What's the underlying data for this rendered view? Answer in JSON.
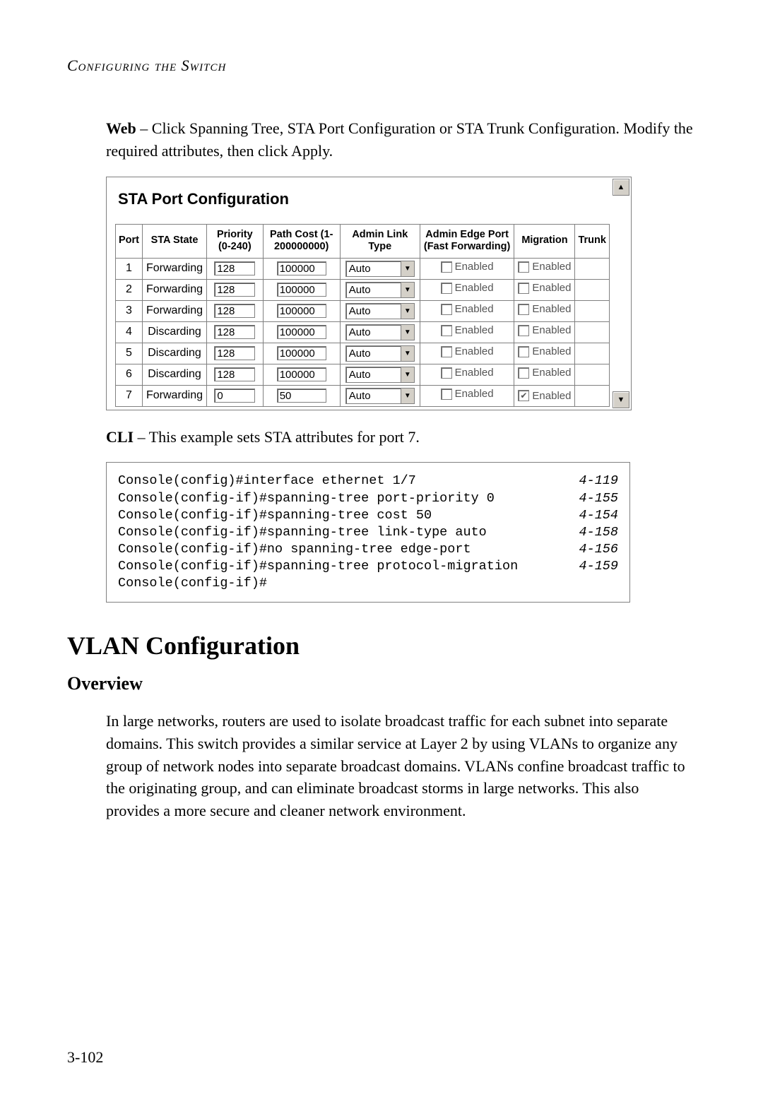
{
  "running_head": "Configuring the Switch",
  "web_para_lead": "Web",
  "web_para_text": " – Click Spanning Tree, STA Port Configuration or STA Trunk Configuration. Modify the required attributes, then click Apply.",
  "sta_title": "STA Port Configuration",
  "headers": {
    "port": "Port",
    "state": "STA State",
    "priority": "Priority (0-240)",
    "cost": "Path Cost (1-200000000)",
    "link": "Admin Link Type",
    "edge": "Admin Edge Port (Fast Forwarding)",
    "migration": "Migration",
    "trunk": "Trunk"
  },
  "link_option": "Auto",
  "enabled_label": "Enabled",
  "rows": [
    {
      "port": "1",
      "state": "Forwarding",
      "prio": "128",
      "cost": "100000",
      "edge": false,
      "mig": false
    },
    {
      "port": "2",
      "state": "Forwarding",
      "prio": "128",
      "cost": "100000",
      "edge": false,
      "mig": false
    },
    {
      "port": "3",
      "state": "Forwarding",
      "prio": "128",
      "cost": "100000",
      "edge": false,
      "mig": false
    },
    {
      "port": "4",
      "state": "Discarding",
      "prio": "128",
      "cost": "100000",
      "edge": false,
      "mig": false
    },
    {
      "port": "5",
      "state": "Discarding",
      "prio": "128",
      "cost": "100000",
      "edge": false,
      "mig": false
    },
    {
      "port": "6",
      "state": "Discarding",
      "prio": "128",
      "cost": "100000",
      "edge": false,
      "mig": false
    },
    {
      "port": "7",
      "state": "Forwarding",
      "prio": "0",
      "cost": "50",
      "edge": false,
      "mig": true
    }
  ],
  "cli_para_lead": "CLI",
  "cli_para_text": " – This example sets STA attributes for port 7.",
  "cli_lines": [
    {
      "cmd": "Console(config)#interface ethernet 1/7",
      "ref": "4-119"
    },
    {
      "cmd": "Console(config-if)#spanning-tree port-priority 0",
      "ref": "4-155"
    },
    {
      "cmd": "Console(config-if)#spanning-tree cost 50",
      "ref": "4-154"
    },
    {
      "cmd": "Console(config-if)#spanning-tree link-type auto",
      "ref": "4-158"
    },
    {
      "cmd": "Console(config-if)#no spanning-tree edge-port",
      "ref": "4-156"
    },
    {
      "cmd": "Console(config-if)#spanning-tree protocol-migration",
      "ref": "4-159"
    },
    {
      "cmd": "Console(config-if)#",
      "ref": ""
    }
  ],
  "h1": "VLAN Configuration",
  "h2": "Overview",
  "overview_para": "In large networks, routers are used to isolate broadcast traffic for each subnet into separate domains. This switch provides a similar service at Layer 2 by using VLANs to organize any group of network nodes into separate broadcast domains. VLANs confine broadcast traffic to the originating group, and can eliminate broadcast storms in large networks. This also provides a more secure and cleaner network environment.",
  "page_number": "3-102",
  "icons": {
    "up": "▲",
    "down": "▼",
    "check": "✔"
  }
}
